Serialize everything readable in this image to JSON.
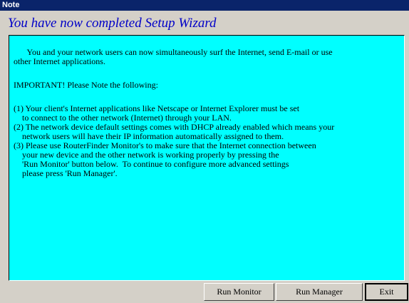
{
  "window": {
    "title": "Note"
  },
  "heading": "You have now completed Setup Wizard",
  "body": {
    "intro": [
      "      You and your network users can now simultaneously surf the Internet, send E-mail or use",
      "other Internet applications."
    ],
    "important": "IMPORTANT! Please Note the following:",
    "notes": [
      "(1) Your client's Internet applications like Netscape or Internet Explorer must be set",
      "    to connect to the other network (Internet) through your LAN.",
      "(2) The network device default settings comes with DHCP already enabled which means your",
      "    network users will have their IP information automatically assigned to them.",
      "(3) Please use RouterFinder Monitor's to make sure that the Internet connection between",
      "    your new device and the other network is working properly by pressing the",
      "    'Run Monitor' button below.  To continue to configure more advanced settings",
      "    please press 'Run Manager'."
    ]
  },
  "buttons": {
    "run_monitor": "Run Monitor",
    "run_manager": "Run Manager",
    "exit": "Exit"
  },
  "colors": {
    "title_bar": "#0a246a",
    "heading_text": "#0000c8",
    "content_bg": "#00ffff",
    "window_bg": "#d4d0c8"
  }
}
